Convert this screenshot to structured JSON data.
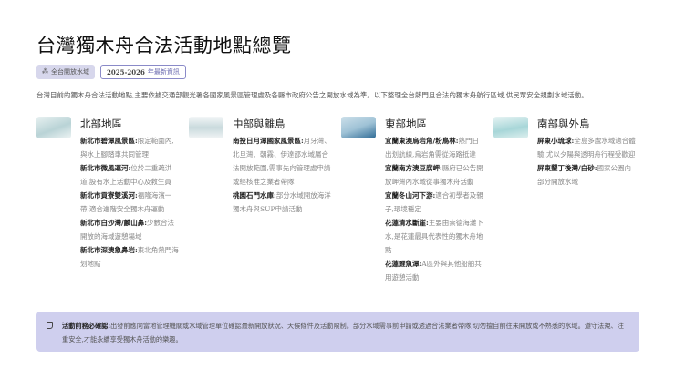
{
  "title": "台灣獨木舟合法活動地點總覽",
  "badges": {
    "b1": "全台開放水域",
    "b2_year": "2025-2026",
    "b2_text": "年最新資訊"
  },
  "intro": "台灣目前的獨木舟合法活動地點,主要依據交通部觀光署各國家風景區管理處及各縣市政府公告之開放水域為準。以下整理全台熱門且合法的獨木舟航行區域,供民眾安全規劃水域活動。",
  "regions": [
    {
      "title": "北部地區",
      "items": [
        {
          "name": "新北市碧潭風景區:",
          "desc": "限定範圍內,與水上腳踏車共同管理"
        },
        {
          "name": "新北市微風運河:",
          "desc": "位於二重疏洪道,設有水上活動中心及救生員"
        },
        {
          "name": "新北市貢寮雙溪河:",
          "desc": "福隆海濱一帶,適合進階安全獨木舟運動"
        },
        {
          "name": "新北市白沙灣/麟山鼻:",
          "desc": "少數合法開放的海域遊憩場域"
        },
        {
          "name": "新北市深澳象鼻岩:",
          "desc": "東北角熱門海划地點"
        }
      ]
    },
    {
      "title": "中部與離島",
      "items": [
        {
          "name": "南投日月潭國家風景區:",
          "desc": "月牙灣、北旦灣、朝霧、伊達邵水域屬合法開放範圍,需事先向管理處申請或經核准之業者帶隊"
        },
        {
          "name": "桃園石門水庫:",
          "desc": "部分水域開放海洋獨木舟與SUP申請活動"
        }
      ]
    },
    {
      "title": "東部地區",
      "items": [
        {
          "name": "宜蘭東澳烏岩角/粉鳥林:",
          "desc": "熱門日出划航線,烏岩角需從海路抵達"
        },
        {
          "name": "宜蘭南方澳豆腐岬:",
          "desc": "縣府已公告開放岬灣內水域從事獨木舟活動"
        },
        {
          "name": "宜蘭冬山河下游:",
          "desc": "適合初學者及親子,環境穩定"
        },
        {
          "name": "花蓮清水斷崖:",
          "desc": "主要由崇德海灘下水,是花蓮最具代表性的獨木舟地點"
        },
        {
          "name": "花蓮鯉魚潭:",
          "desc": "A區外與其他船舶共用遊憩活動"
        }
      ]
    },
    {
      "title": "南部與外島",
      "items": [
        {
          "name": "屏東小琉球:",
          "desc": "全島多處水域適合體驗,尤以夕陽與透明舟行程受歡迎"
        },
        {
          "name": "屏東墾丁後灣/白砂:",
          "desc": "國家公園內部分開放水域"
        }
      ]
    }
  ],
  "note": {
    "label": "活動前務必確認:",
    "text": "出發前應向當地管理機關或水域管理單位確認最新開放狀況、天候條件及活動限制。部分水域需事前申請或透過合法業者帶隊,切勿擅自前往未開放或不熟悉的水域。遵守法規、注重安全,才能永續享受獨木舟活動的樂趣。"
  }
}
